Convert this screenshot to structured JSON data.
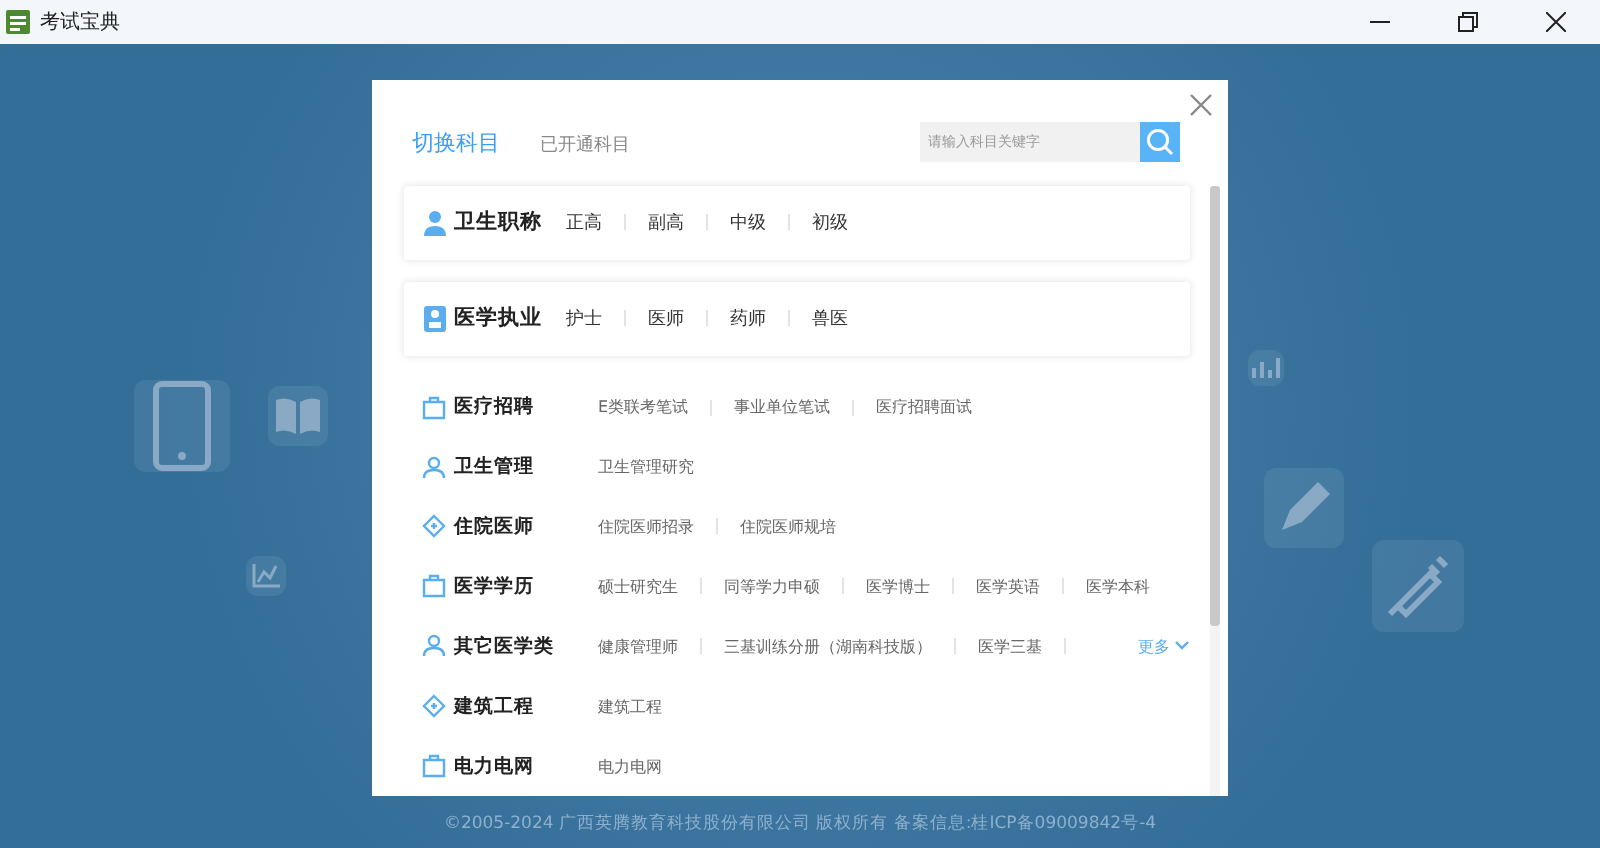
{
  "window": {
    "title": "考试宝典"
  },
  "modal": {
    "tabs": [
      {
        "label": "切换科目",
        "selected": true
      },
      {
        "label": "已开通科目",
        "selected": false
      }
    ],
    "search": {
      "placeholder": "请输入科目关键字"
    },
    "featured": [
      {
        "title": "卫生职称",
        "items": [
          "正高",
          "副高",
          "中级",
          "初级"
        ]
      },
      {
        "title": "医学执业",
        "items": [
          "护士",
          "医师",
          "药师",
          "兽医"
        ]
      }
    ],
    "groups": [
      {
        "title": "医疗招聘",
        "items": [
          "E类联考笔试",
          "事业单位笔试",
          "医疗招聘面试"
        ]
      },
      {
        "title": "卫生管理",
        "items": [
          "卫生管理研究"
        ]
      },
      {
        "title": "住院医师",
        "items": [
          "住院医师招录",
          "住院医师规培"
        ]
      },
      {
        "title": "医学学历",
        "items": [
          "硕士研究生",
          "同等学力申硕",
          "医学博士",
          "医学英语",
          "医学本科"
        ]
      },
      {
        "title": "其它医学类",
        "items": [
          "健康管理师",
          "三基训练分册（湖南科技版）",
          "医学三基"
        ],
        "more": "更多"
      },
      {
        "title": "建筑工程",
        "items": [
          "建筑工程"
        ]
      },
      {
        "title": "电力电网",
        "items": [
          "电力电网"
        ]
      }
    ]
  },
  "footer": "©2005-2024  广西英腾教育科技股份有限公司 版权所有  备案信息:桂ICP备09009842号-4"
}
